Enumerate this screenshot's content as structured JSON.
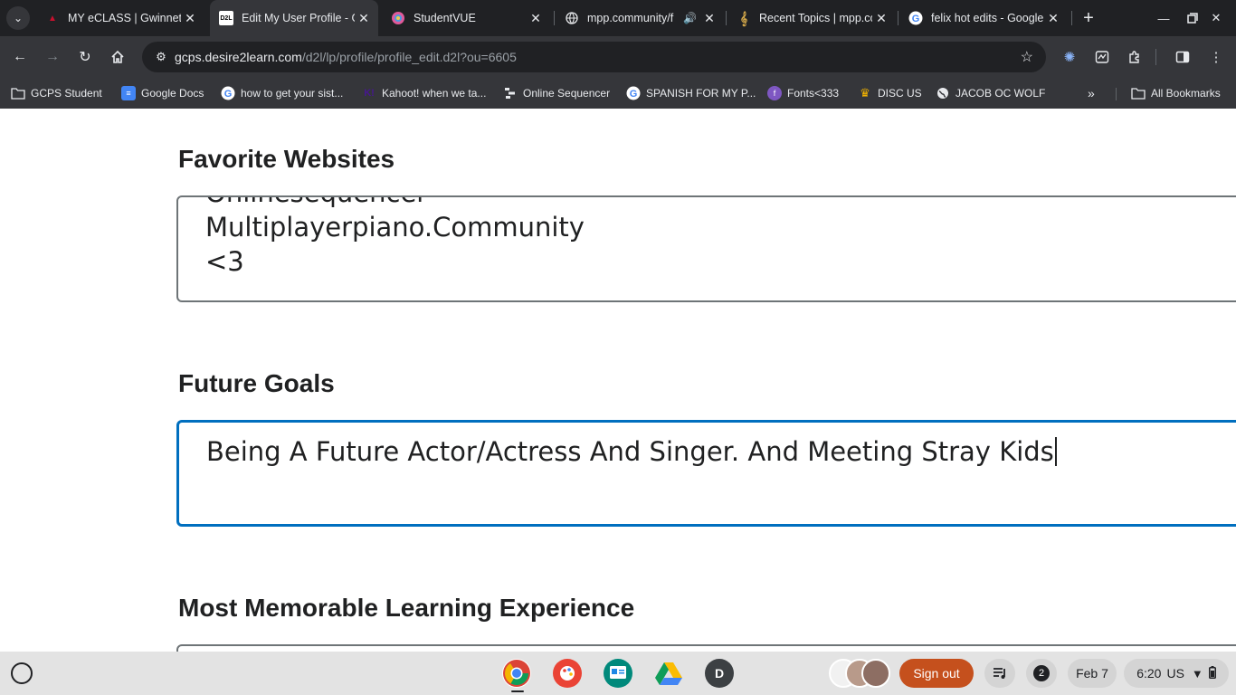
{
  "tabs": [
    {
      "title": "MY eCLASS | Gwinnett",
      "favicon": "eclass-icon"
    },
    {
      "title": "Edit My User Profile - G",
      "favicon": "d2l-icon"
    },
    {
      "title": "StudentVUE",
      "favicon": "studentvue-icon"
    },
    {
      "title": "mpp.community/f",
      "favicon": "globe-icon"
    },
    {
      "title": "Recent Topics | mpp.co",
      "favicon": "music-icon"
    },
    {
      "title": "felix hot edits - Google",
      "favicon": "google-icon"
    }
  ],
  "toolbar": {
    "url_host": "gcps.desire2learn.com",
    "url_path": "/d2l/lp/profile/profile_edit.d2l?ou=6605"
  },
  "bookmarks": [
    {
      "label": "GCPS Student",
      "icon": "folder-icon"
    },
    {
      "label": "Google Docs",
      "icon": "docs-icon"
    },
    {
      "label": "how to get your sist...",
      "icon": "google-icon"
    },
    {
      "label": "Kahoot! when we ta...",
      "icon": "kahoot-icon"
    },
    {
      "label": "Online Sequencer",
      "icon": "sequencer-icon"
    },
    {
      "label": "SPANISH FOR MY P...",
      "icon": "google-icon"
    },
    {
      "label": "Fonts<333",
      "icon": "fonts-icon"
    },
    {
      "label": "DISC US",
      "icon": "crown-icon"
    },
    {
      "label": "JACOB OC WOLF",
      "icon": "globe-icon"
    }
  ],
  "all_bookmarks_label": "All Bookmarks",
  "sections": {
    "favorite_websites": {
      "label": "Favorite Websites",
      "lines": [
        "Onlinesequencer",
        "Multiplayerpiano.Community",
        "<3"
      ]
    },
    "future_goals": {
      "label": "Future Goals",
      "value": "Being A Future Actor/Actress And Singer. And Meeting Stray Kids"
    },
    "memorable": {
      "label": "Most Memorable Learning Experience"
    }
  },
  "shelf": {
    "account_initial": "D",
    "signout_label": "Sign out",
    "notification_count": "2",
    "date": "Feb 7",
    "time": "6:20",
    "locale": "US"
  }
}
